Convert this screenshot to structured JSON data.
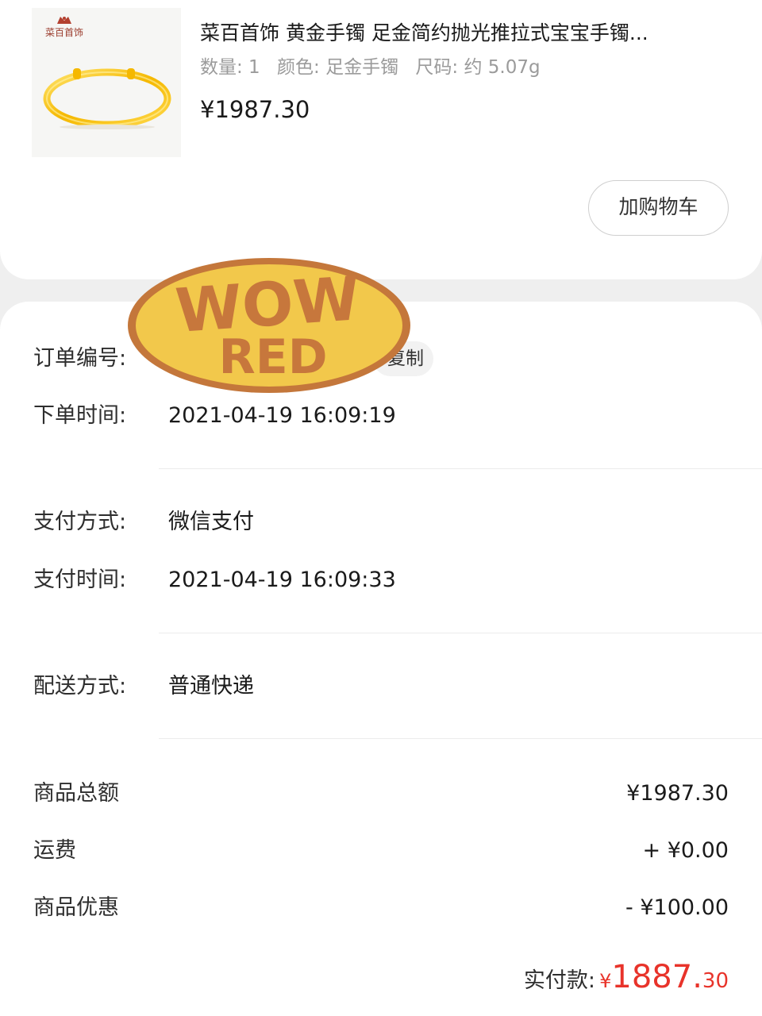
{
  "product": {
    "brand_logo_text": "菜百首饰",
    "title": "菜百首饰 黄金手镯 足金简约抛光推拉式宝宝手镯...",
    "specs": {
      "quantity": "数量: 1",
      "color": "颜色: 足金手镯",
      "size": "尺码: 约 5.07g"
    },
    "price": "¥1987.30",
    "add_to_cart_label": "加购物车"
  },
  "order": {
    "order_no_label": "订单编号:",
    "copy_label": "复制",
    "order_time_label": "下单时间:",
    "order_time": "2021-04-19 16:09:19",
    "pay_method_label": "支付方式:",
    "pay_method": "微信支付",
    "pay_time_label": "支付时间:",
    "pay_time": "2021-04-19 16:09:33",
    "delivery_label": "配送方式:",
    "delivery": "普通快递"
  },
  "summary": {
    "goods_total_label": "商品总额",
    "goods_total": "¥1987.30",
    "shipping_label": "运费",
    "shipping": "+ ¥0.00",
    "discount_label": "商品优惠",
    "discount": "- ¥100.00",
    "paid_label": "实付款:",
    "paid_currency": "¥",
    "paid_integer": "1887.",
    "paid_decimal": "30"
  },
  "watermark": {
    "line1": "WOW",
    "line2": "RED"
  },
  "colors": {
    "accent_red": "#e8332a",
    "stamp_fill": "#f2c84b",
    "stamp_text": "#c7773c"
  }
}
